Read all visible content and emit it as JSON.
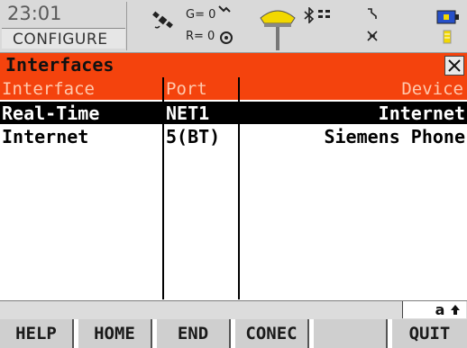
{
  "status": {
    "time": "23:01",
    "context": "CONFIGURE",
    "satellite_g": "G= 0",
    "satellite_r": "R= 0"
  },
  "panel": {
    "title": "Interfaces"
  },
  "table": {
    "headers": {
      "interface": "Interface",
      "port": "Port",
      "device": "Device"
    },
    "rows": [
      {
        "interface": "Real-Time",
        "port": "NET1",
        "device": "Internet"
      },
      {
        "interface": "Internet",
        "port": "5(BT)",
        "device": "Siemens Phone"
      }
    ],
    "selected_row": 0
  },
  "input_mode": "a",
  "fkeys": [
    "HELP",
    "HOME",
    "END",
    "CONEC",
    "",
    "QUIT"
  ],
  "colors": {
    "accent": "#f4430d",
    "header_text": "#ffc9ae",
    "selected_row": "#000000"
  }
}
